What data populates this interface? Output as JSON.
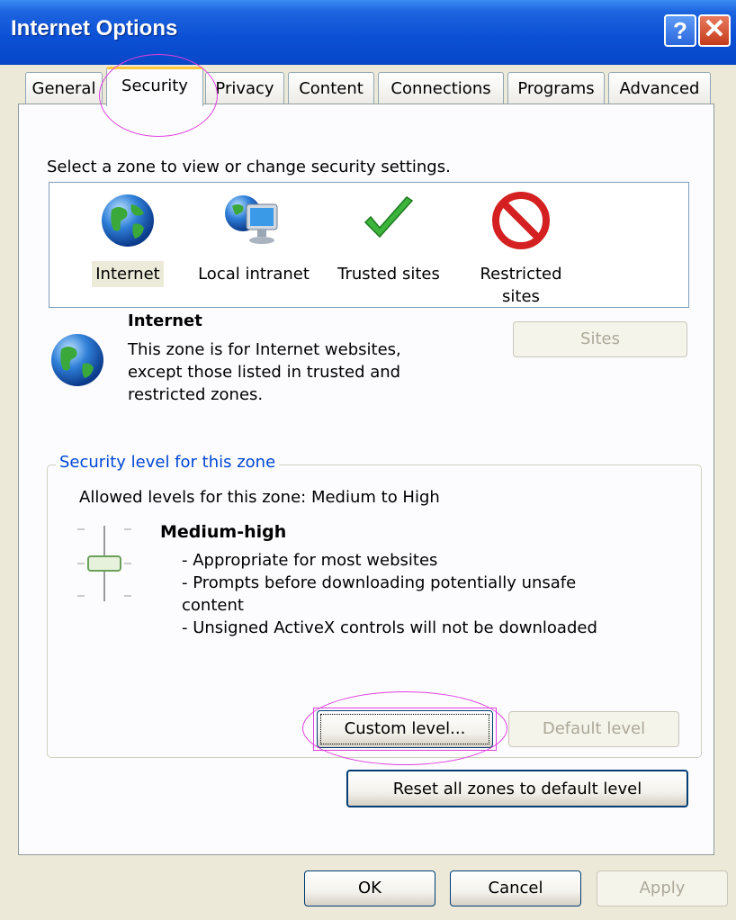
{
  "window": {
    "title": "Internet Options",
    "help_label": "?",
    "close_label": "✕"
  },
  "tabs": [
    {
      "label": "General"
    },
    {
      "label": "Security"
    },
    {
      "label": "Privacy"
    },
    {
      "label": "Content"
    },
    {
      "label": "Connections"
    },
    {
      "label": "Programs"
    },
    {
      "label": "Advanced"
    }
  ],
  "active_tab": "Security",
  "zone_select_prompt": "Select a zone to view or change security settings.",
  "zones": [
    {
      "label": "Internet",
      "icon": "globe-icon",
      "selected": true
    },
    {
      "label": "Local intranet",
      "icon": "intranet-monitor-icon",
      "selected": false
    },
    {
      "label": "Trusted sites",
      "icon": "checkmark-icon",
      "selected": false
    },
    {
      "label": "Restricted sites",
      "icon": "prohibited-icon",
      "selected": false
    }
  ],
  "zone_info": {
    "name": "Internet",
    "description": "This zone is for Internet websites, except those listed in trusted and restricted zones.",
    "sites_button": "Sites"
  },
  "security_level": {
    "group_title": "Security level for this zone",
    "allowed_levels": "Allowed levels for this zone: Medium to High",
    "level_name": "Medium-high",
    "bullets": [
      "- Appropriate for most websites",
      "- Prompts before downloading potentially unsafe",
      "content",
      "- Unsigned ActiveX controls will not be downloaded"
    ],
    "custom_level_button": "Custom level...",
    "default_level_button": "Default level"
  },
  "reset_button": "Reset all zones to default level",
  "footer": {
    "ok": "OK",
    "cancel": "Cancel",
    "apply": "Apply"
  },
  "colors": {
    "title_bar": "#0a4fd4",
    "annotation": "#e040e0",
    "group_title": "#0046d5"
  }
}
